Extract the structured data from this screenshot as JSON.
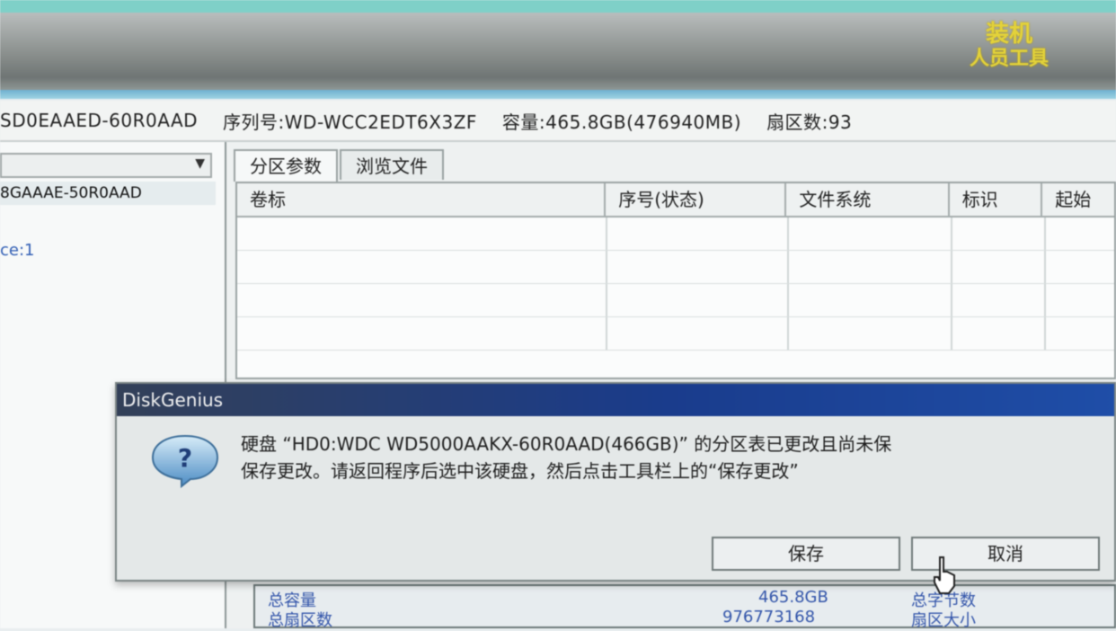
{
  "logo": {
    "line1": "装机",
    "line2": "人员工具"
  },
  "disk_info": {
    "model": "SD0EAAED-60R0AAD",
    "serial_label": "序列号",
    "serial_value": "WD-WCC2EDT6X3ZF",
    "capacity_label": "容量",
    "capacity_value": "465.8GB(476940MB)",
    "sector_label": "扇区数",
    "sector_value": "93"
  },
  "left": {
    "select_arrow": "▼",
    "item": "8GAAAE-50R0AAD",
    "sub": "ce:1"
  },
  "tabs": [
    {
      "label": "分区参数"
    },
    {
      "label": "浏览文件"
    }
  ],
  "table": {
    "columns": [
      "卷标",
      "序号(状态)",
      "文件系统",
      "标识",
      "起始"
    ]
  },
  "bottom": {
    "label1": "总容量",
    "label2": "总扇区数",
    "value1": "465.8GB",
    "value2": "976773168",
    "label3": "总字节数",
    "label4": "扇区大小"
  },
  "dialog": {
    "title": "DiskGenius",
    "line1": "硬盘 “HD0:WDC WD5000AAKX-60R0AAD(466GB)” 的分区表已更改且尚未保",
    "line2": "保存更改。请返回程序后选中该硬盘，然后点击工具栏上的“保存更改”",
    "ok_label": "保存",
    "cancel_label": "取消",
    "icon": "question-icon"
  }
}
